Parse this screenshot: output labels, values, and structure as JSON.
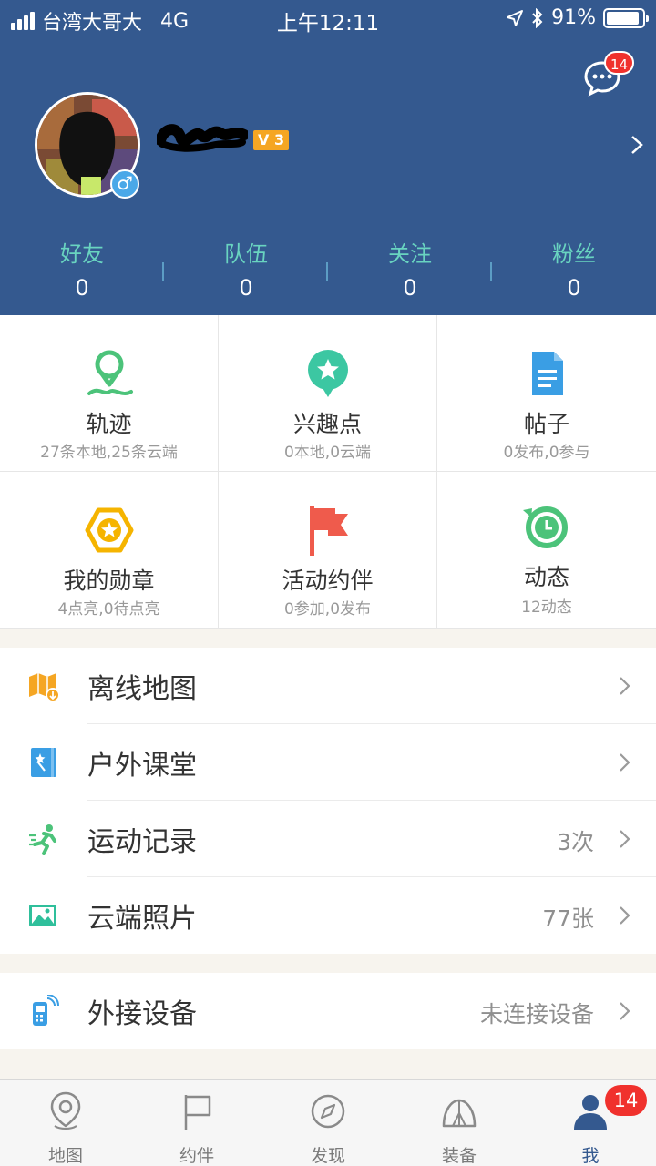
{
  "status_bar": {
    "carrier": "台湾大哥大",
    "network": "4G",
    "time": "上午12:11",
    "battery": "91%",
    "battery_level": 0.91
  },
  "header": {
    "message_badge": "14",
    "level": "3",
    "stats": [
      {
        "label": "好友",
        "value": "0"
      },
      {
        "label": "队伍",
        "value": "0"
      },
      {
        "label": "关注",
        "value": "0"
      },
      {
        "label": "粉丝",
        "value": "0"
      }
    ]
  },
  "grid": [
    {
      "title": "轨迹",
      "sub": "27条本地,25条云端",
      "icon": "track-pin-icon"
    },
    {
      "title": "兴趣点",
      "sub": "0本地,0云端",
      "icon": "poi-star-icon"
    },
    {
      "title": "帖子",
      "sub": "0发布,0参与",
      "icon": "document-icon"
    },
    {
      "title": "我的勋章",
      "sub": "4点亮,0待点亮",
      "icon": "medal-icon"
    },
    {
      "title": "活动约伴",
      "sub": "0参加,0发布",
      "icon": "flag-icon"
    },
    {
      "title": "动态",
      "sub": "12动态",
      "icon": "clock-refresh-icon"
    }
  ],
  "menu": [
    {
      "label": "离线地图",
      "value": "",
      "icon": "offline-map-icon"
    },
    {
      "label": "户外课堂",
      "value": "",
      "icon": "outdoor-class-icon"
    },
    {
      "label": "运动记录",
      "value": "3次",
      "icon": "running-icon"
    },
    {
      "label": "云端照片",
      "value": "77张",
      "icon": "photo-icon"
    }
  ],
  "device": {
    "label": "外接设备",
    "value": "未连接设备",
    "icon": "device-icon"
  },
  "tabbar": {
    "tabs": [
      {
        "label": "地图",
        "icon": "map-pin-icon"
      },
      {
        "label": "约伴",
        "icon": "flag-tab-icon"
      },
      {
        "label": "发现",
        "icon": "compass-icon"
      },
      {
        "label": "装备",
        "icon": "tent-icon"
      },
      {
        "label": "我",
        "icon": "user-icon"
      }
    ],
    "badge": "14"
  },
  "colors": {
    "header_bg": "#34598f",
    "stat_label": "#69d4c0",
    "badge_red": "#f0312d",
    "green": "#4cc37a",
    "orange": "#f5a623",
    "red": "#ef5b4c",
    "blue": "#3a9ee4"
  }
}
